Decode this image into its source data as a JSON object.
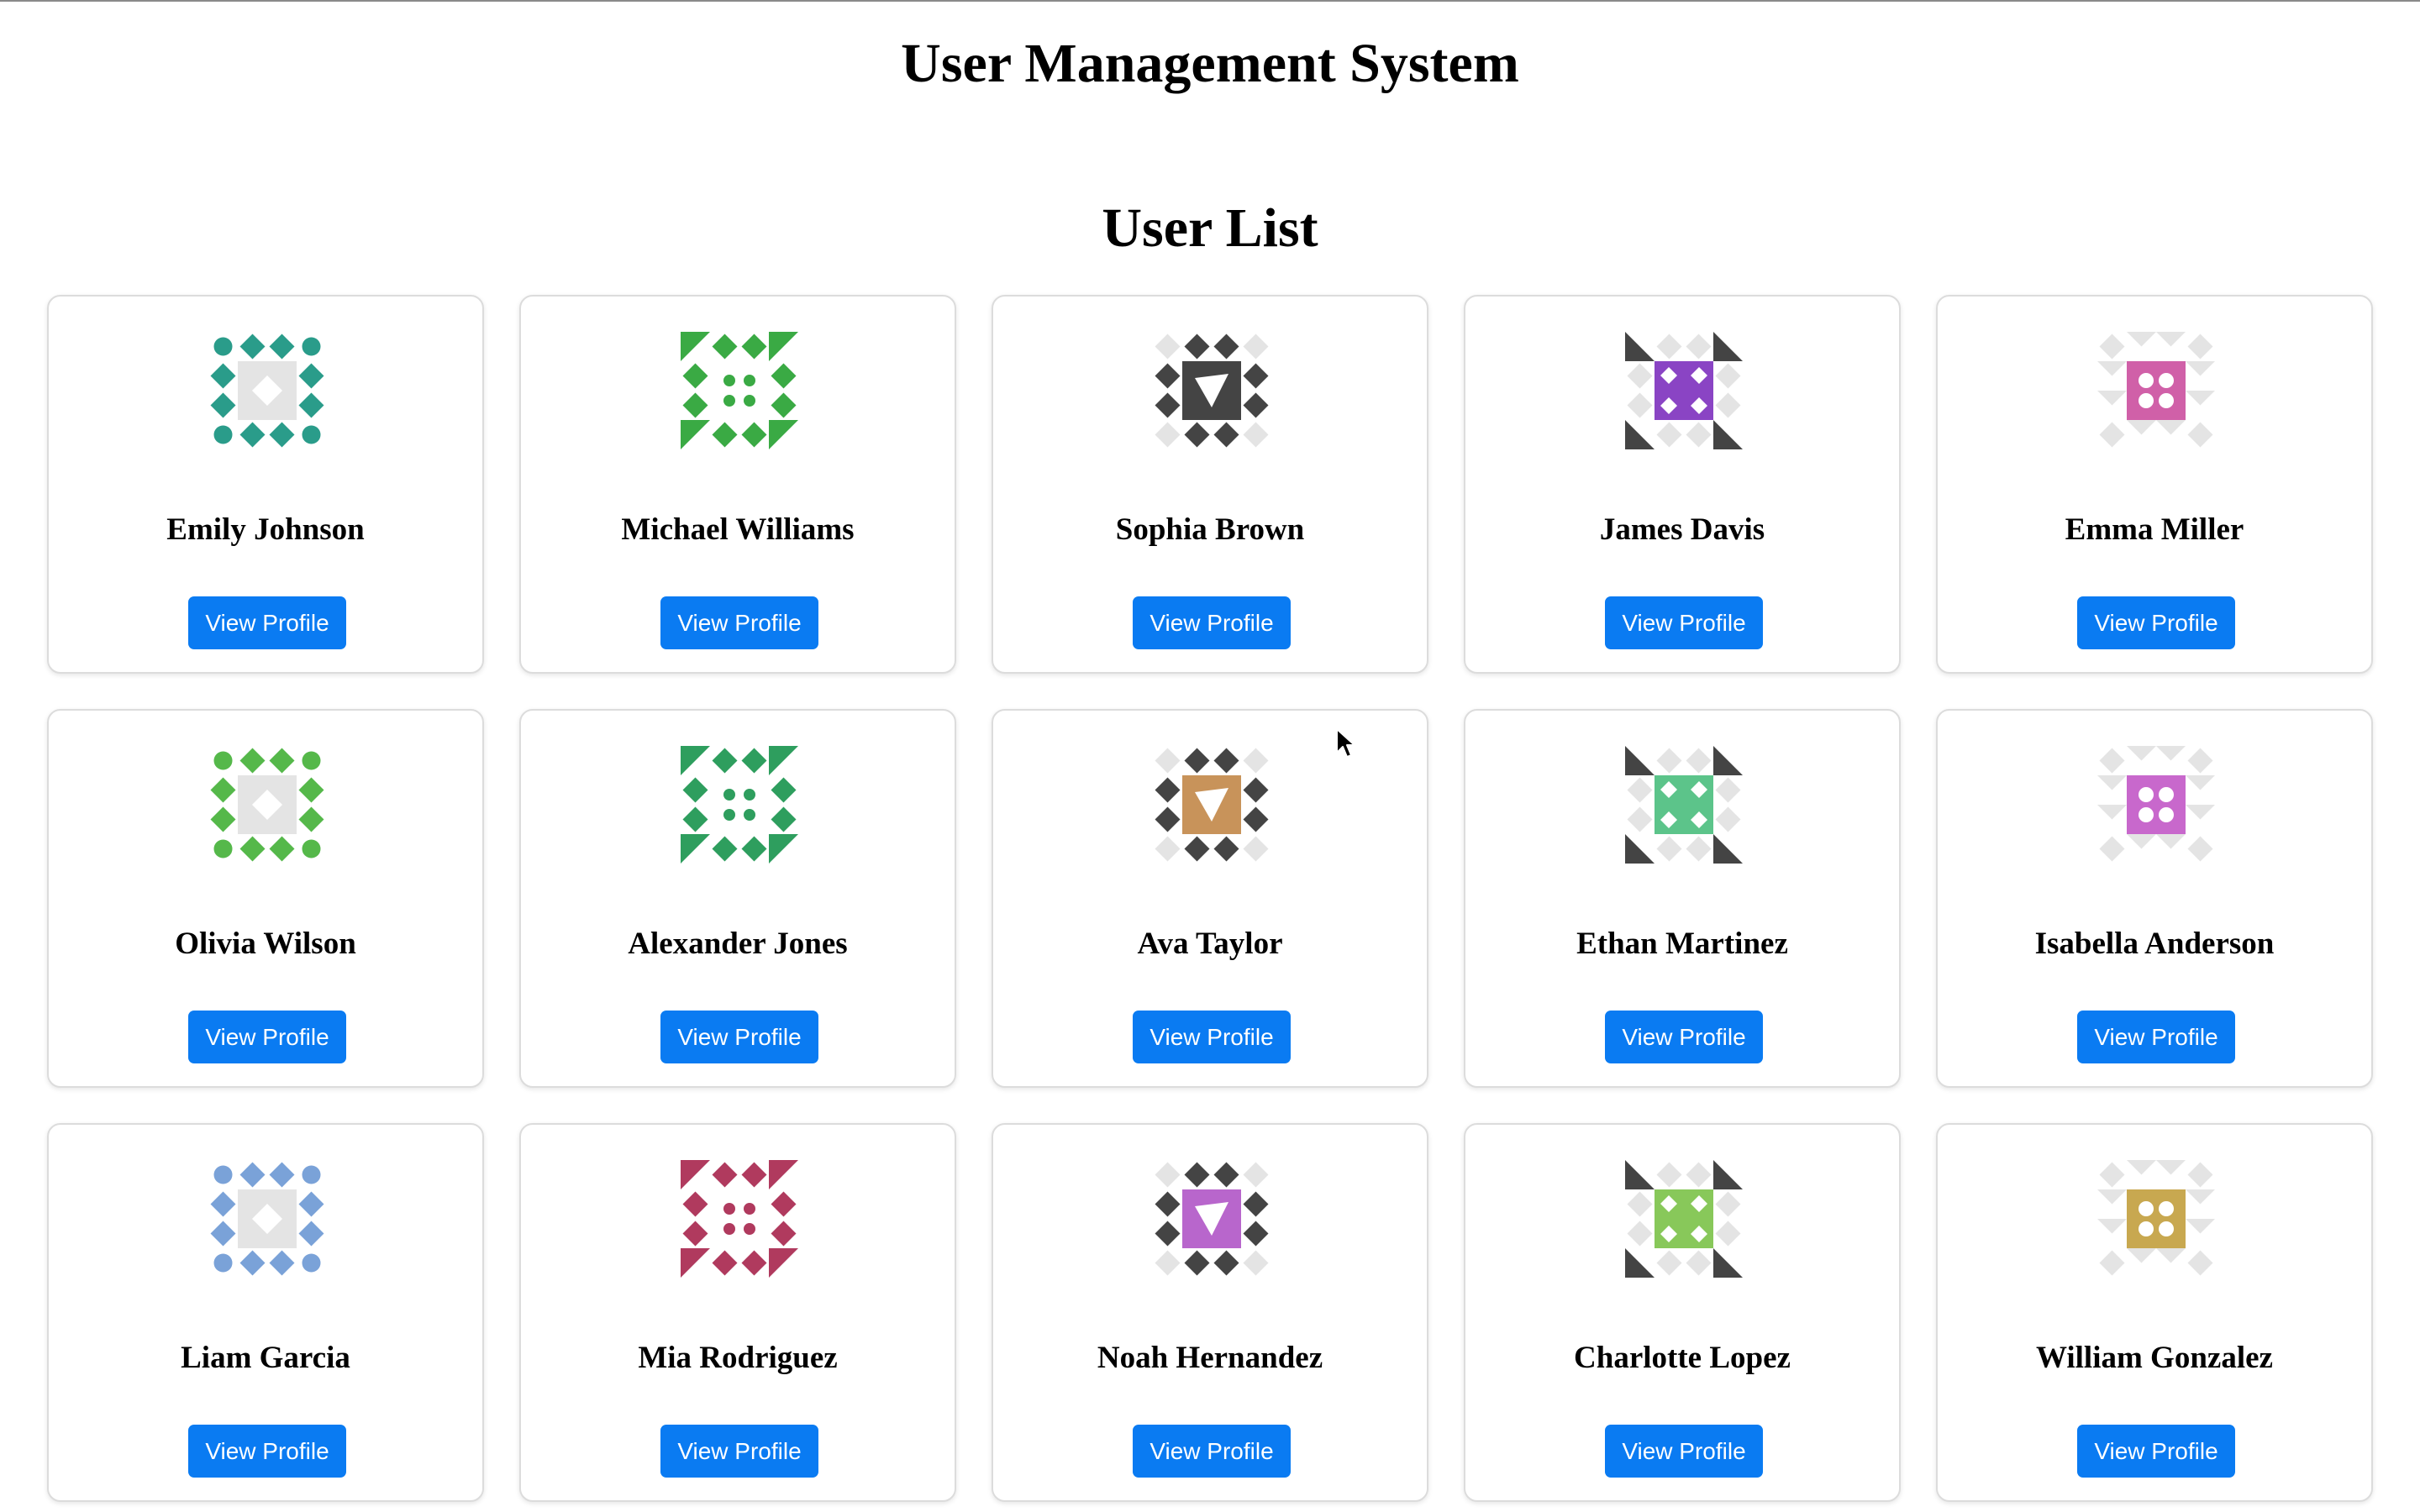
{
  "page": {
    "title": "User Management System",
    "section_title": "User List"
  },
  "theme": {
    "button_color": "#0a7bf2",
    "card_border": "#dcdcdc"
  },
  "users": [
    {
      "name": "Emily Johnson",
      "button_label": "View Profile",
      "avatar_icon": "identicon-teal",
      "avatar_color": "#2a9c8a"
    },
    {
      "name": "Michael Williams",
      "button_label": "View Profile",
      "avatar_icon": "identicon-green",
      "avatar_color": "#3aaa44"
    },
    {
      "name": "Sophia Brown",
      "button_label": "View Profile",
      "avatar_icon": "identicon-dark-green",
      "avatar_color": "#444444"
    },
    {
      "name": "James Davis",
      "button_label": "View Profile",
      "avatar_icon": "identicon-purple",
      "avatar_color": "#8a44c4"
    },
    {
      "name": "Emma Miller",
      "button_label": "View Profile",
      "avatar_icon": "identicon-pink",
      "avatar_color": "#d060a8"
    },
    {
      "name": "Olivia Wilson",
      "button_label": "View Profile",
      "avatar_icon": "identicon-green-dark",
      "avatar_color": "#55b84a"
    },
    {
      "name": "Alexander Jones",
      "button_label": "View Profile",
      "avatar_icon": "identicon-mint",
      "avatar_color": "#2e9e5e"
    },
    {
      "name": "Ava Taylor",
      "button_label": "View Profile",
      "avatar_icon": "identicon-tan",
      "avatar_color": "#c8935a"
    },
    {
      "name": "Ethan Martinez",
      "button_label": "View Profile",
      "avatar_icon": "identicon-light-green",
      "avatar_color": "#5cc48a"
    },
    {
      "name": "Isabella Anderson",
      "button_label": "View Profile",
      "avatar_icon": "identicon-orchid",
      "avatar_color": "#c868cc"
    },
    {
      "name": "Liam Garcia",
      "button_label": "View Profile",
      "avatar_icon": "identicon-blue",
      "avatar_color": "#7aa2d8"
    },
    {
      "name": "Mia Rodriguez",
      "button_label": "View Profile",
      "avatar_icon": "identicon-crimson",
      "avatar_color": "#b03a5e"
    },
    {
      "name": "Noah Hernandez",
      "button_label": "View Profile",
      "avatar_icon": "identicon-violet",
      "avatar_color": "#b866cc"
    },
    {
      "name": "Charlotte Lopez",
      "button_label": "View Profile",
      "avatar_icon": "identicon-lime",
      "avatar_color": "#88c85a"
    },
    {
      "name": "William Gonzalez",
      "button_label": "View Profile",
      "avatar_icon": "identicon-gold",
      "avatar_color": "#c8a850"
    }
  ]
}
